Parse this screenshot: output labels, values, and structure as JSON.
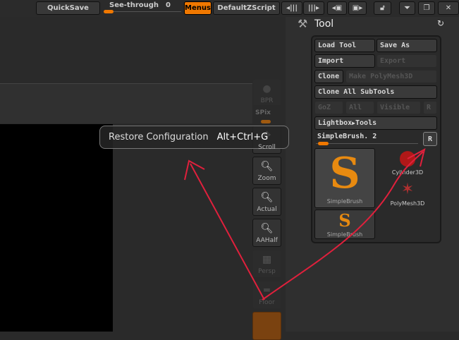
{
  "topbar": {
    "quicksave": "QuickSave",
    "see_through_label": "See-through",
    "see_through_value": "0",
    "see_through_fraction": 0,
    "menus": "Menus",
    "script": "DefaultZScript"
  },
  "tooltip": {
    "label": "Restore Configuration",
    "shortcut": "Alt+Ctrl+G"
  },
  "sidebar": {
    "bpr": "BPR",
    "spix": "SPix",
    "scroll": "Scroll",
    "zoom": "Zoom",
    "actual": "Actual",
    "aahalf": "AAHalf",
    "persp": "Persp",
    "floor": "Floor"
  },
  "tool_panel": {
    "title": "Tool",
    "load_tool": "Load Tool",
    "save_as": "Save As",
    "import": "Import",
    "export": "Export",
    "clone": "Clone",
    "make_polymesh": "Make PolyMesh3D",
    "clone_all": "Clone All SubTools",
    "goz": "GoZ",
    "all": "All",
    "visible": "Visible",
    "r": "R",
    "lightbox": "Lightbox",
    "lightbox_tools": "Tools",
    "current_tool": "SimpleBrush. 2",
    "r_button": "R",
    "thumbs": [
      "SimpleBrush",
      "Cylinder3D",
      "PolyMesh3D",
      "SimpleBrush"
    ]
  },
  "colors": {
    "accent": "#f07800",
    "annotation": "#e0203c"
  }
}
